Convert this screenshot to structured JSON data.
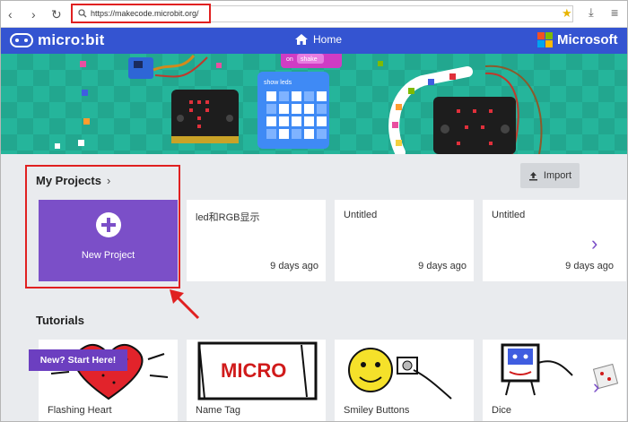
{
  "browser": {
    "back": "‹",
    "forward": "›",
    "reload": "↻",
    "url": "https://makecode.microbit.org/",
    "star": "★",
    "download": "⤓",
    "menu": "≡"
  },
  "header": {
    "brand": "micro:bit",
    "home_label": "Home",
    "partner": "Microsoft",
    "colors": {
      "bar": "#3454d1",
      "ms_red": "#f25022",
      "ms_green": "#7fba00",
      "ms_blue": "#00a4ef",
      "ms_yellow": "#ffb900"
    }
  },
  "banner": {
    "block_on": "on",
    "block_shake": "shake",
    "block_show_leds": "show leds"
  },
  "projects": {
    "title": "My Projects",
    "chevron": "›",
    "import_label": "Import",
    "new_project_label": "New Project",
    "items": [
      {
        "title": "led和RGB显示",
        "date": "9 days ago"
      },
      {
        "title": "Untitled",
        "date": "9 days ago"
      },
      {
        "title": "Untitled",
        "date": "9 days ago"
      }
    ],
    "next": "›"
  },
  "tutorials": {
    "title": "Tutorials",
    "ribbon": "New? Start Here!",
    "items": [
      {
        "title": "Flashing Heart"
      },
      {
        "title": "Name Tag",
        "art_text": "MICRO"
      },
      {
        "title": "Smiley Buttons"
      },
      {
        "title": "Dice"
      }
    ],
    "next": "›"
  },
  "accent": "#7b4fc8"
}
